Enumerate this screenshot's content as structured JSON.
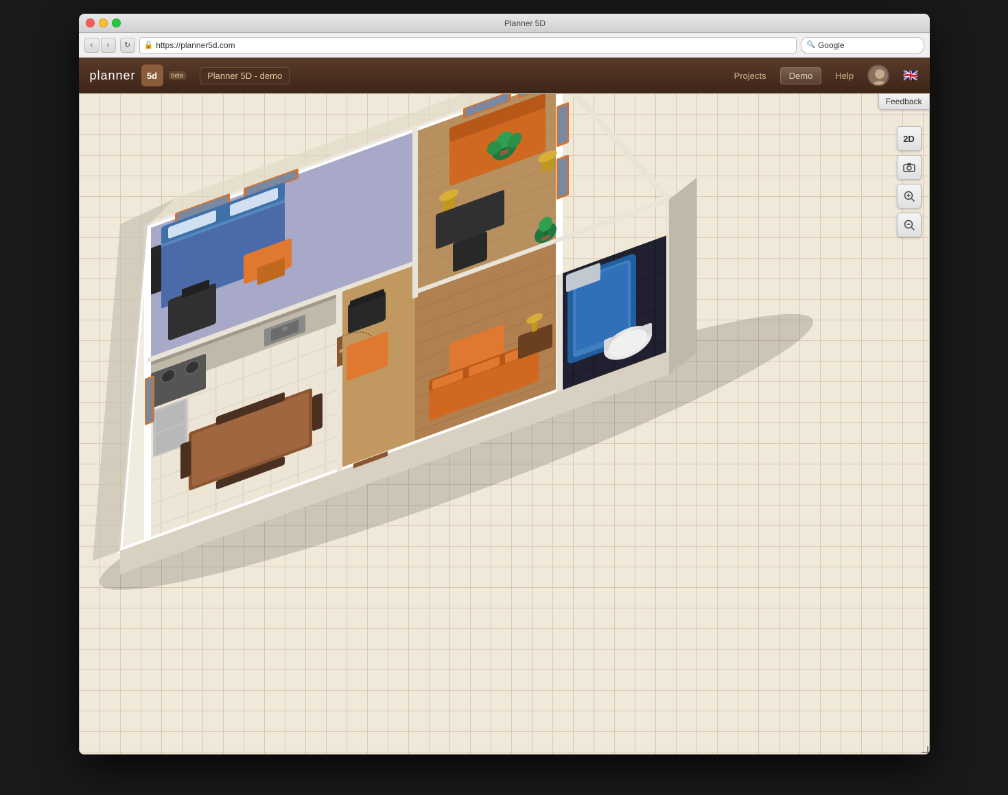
{
  "window": {
    "title": "Planner 5D",
    "url": "https://planner5d.com",
    "search_placeholder": "Google"
  },
  "header": {
    "logo_text": "planner",
    "logo_suffix": "5d",
    "beta_label": "beta",
    "project_name": "Planner 5D - demo",
    "nav": {
      "projects_label": "Projects",
      "demo_label": "Demo",
      "help_label": "Help"
    }
  },
  "toolbar": {
    "feedback_label": "Feedback",
    "view_2d_label": "2D",
    "camera_icon": "📷",
    "zoom_in_icon": "🔍",
    "zoom_out_icon": "🔍"
  },
  "nav_buttons": {
    "back": "‹",
    "forward": "›",
    "reload": "↻"
  },
  "colors": {
    "header_bg": "#3d2518",
    "grid_bg": "#f0e8d8",
    "accent_orange": "#e07830",
    "accent_blue": "#4a7ab5",
    "toolbar_bg": "#e8e8e8"
  }
}
